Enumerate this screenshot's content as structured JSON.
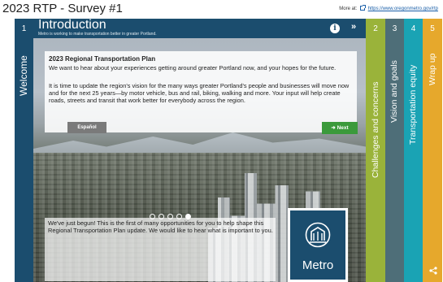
{
  "app": {
    "title": "2023 RTP - Survey #1",
    "more_at_label": "More at:",
    "more_at_link": "https://www.oregonmetro.gov/rtp"
  },
  "colors": {
    "navy": "#1b4d6e",
    "step2": "#9ab33a",
    "step3": "#4e6e78",
    "step4": "#1aa3b4",
    "step5": "#e6a82c",
    "next_green": "#3b9a3b"
  },
  "steps": [
    {
      "number": "1",
      "label": "Welcome"
    },
    {
      "number": "2",
      "label": "Challenges and concerns"
    },
    {
      "number": "3",
      "label": "Vision and goals"
    },
    {
      "number": "4",
      "label": "Transportation equity"
    },
    {
      "number": "5",
      "label": "Wrap up"
    }
  ],
  "stage": {
    "title": "Introduction",
    "subtitle": "Metro is working to make transportation better in greater Portland.",
    "info_icon": "info-icon",
    "next_icon": "double-chevron-right-icon",
    "next_glyph": "»",
    "info_glyph": "i"
  },
  "intro": {
    "heading": "2023 Regional Transportation Plan",
    "paragraph1": "We want to hear about your experiences getting around greater Portland now, and your hopes for the future.",
    "paragraph2": "It is time to update the region's vision for the many ways greater Portland's people and businesses will move now and for the next 25 years—by motor vehicle, bus and rail, biking, walking and more. Your input will help create roads, streets and transit that work better for everybody across the region.",
    "espanol_label": "Español",
    "next_label": "➜ Next"
  },
  "carousel": {
    "total": 5,
    "active_index": 4
  },
  "begun": {
    "text": "We've just begun! This is the first of many opportunities for you to help shape this Regional Transportation Plan update. We would like to hear what is important to you."
  },
  "logo": {
    "wordmark": "Metro",
    "icon": "metro-building-icon"
  },
  "share_icon": "share-icon"
}
